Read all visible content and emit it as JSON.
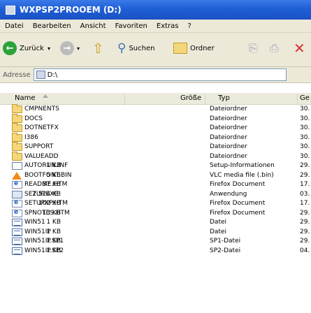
{
  "window": {
    "title": "WXPSP2PROOEM (D:)"
  },
  "menu": [
    "Datei",
    "Bearbeiten",
    "Ansicht",
    "Favoriten",
    "Extras",
    "?"
  ],
  "toolbar": {
    "back_label": "Zurück",
    "search_label": "Suchen",
    "folders_label": "Ordner"
  },
  "address": {
    "label": "Adresse",
    "value": "D:\\"
  },
  "columns": {
    "name": "Name",
    "size": "Größe",
    "type": "Typ",
    "date": "Ge"
  },
  "files": [
    {
      "name": "CMPNENTS",
      "size": "",
      "type": "Dateiordner",
      "date": "30.",
      "icon": "folder"
    },
    {
      "name": "DOCS",
      "size": "",
      "type": "Dateiordner",
      "date": "30.",
      "icon": "folder"
    },
    {
      "name": "DOTNETFX",
      "size": "",
      "type": "Dateiordner",
      "date": "30.",
      "icon": "folder"
    },
    {
      "name": "I386",
      "size": "",
      "type": "Dateiordner",
      "date": "30.",
      "icon": "folder"
    },
    {
      "name": "SUPPORT",
      "size": "",
      "type": "Dateiordner",
      "date": "30.",
      "icon": "folder"
    },
    {
      "name": "VALUEADD",
      "size": "",
      "type": "Dateiordner",
      "date": "30.",
      "icon": "folder"
    },
    {
      "name": "AUTORUN.INF",
      "size": "1 KB",
      "type": "Setup-Informationen",
      "date": "29.",
      "icon": "file"
    },
    {
      "name": "BOOTFONT.BIN",
      "size": "5 KB",
      "type": "VLC media file (.bin)",
      "date": "29.",
      "icon": "vlc"
    },
    {
      "name": "README.HTM",
      "size": "37 KB",
      "type": "Firefox Document",
      "date": "17.",
      "icon": "htm"
    },
    {
      "name": "SETUP.EXE",
      "size": "2.524 KB",
      "type": "Anwendung",
      "date": "03.",
      "icon": "exe"
    },
    {
      "name": "SETUPXP.HTM",
      "size": "102 KB",
      "type": "Firefox Document",
      "date": "17.",
      "icon": "htm"
    },
    {
      "name": "SPNOTES.HTM",
      "size": "13 KB",
      "type": "Firefox Document",
      "date": "29.",
      "icon": "htm"
    },
    {
      "name": "WIN51",
      "size": "1 KB",
      "type": "Datei",
      "date": "29.",
      "icon": "win"
    },
    {
      "name": "WIN51IP",
      "size": "1 KB",
      "type": "Datei",
      "date": "29.",
      "icon": "win"
    },
    {
      "name": "WIN51IP.SP1",
      "size": "1 KB",
      "type": "SP1-Datei",
      "date": "29.",
      "icon": "win"
    },
    {
      "name": "WIN51IP.SP2",
      "size": "1 KB",
      "type": "SP2-Datei",
      "date": "04.",
      "icon": "win"
    }
  ]
}
